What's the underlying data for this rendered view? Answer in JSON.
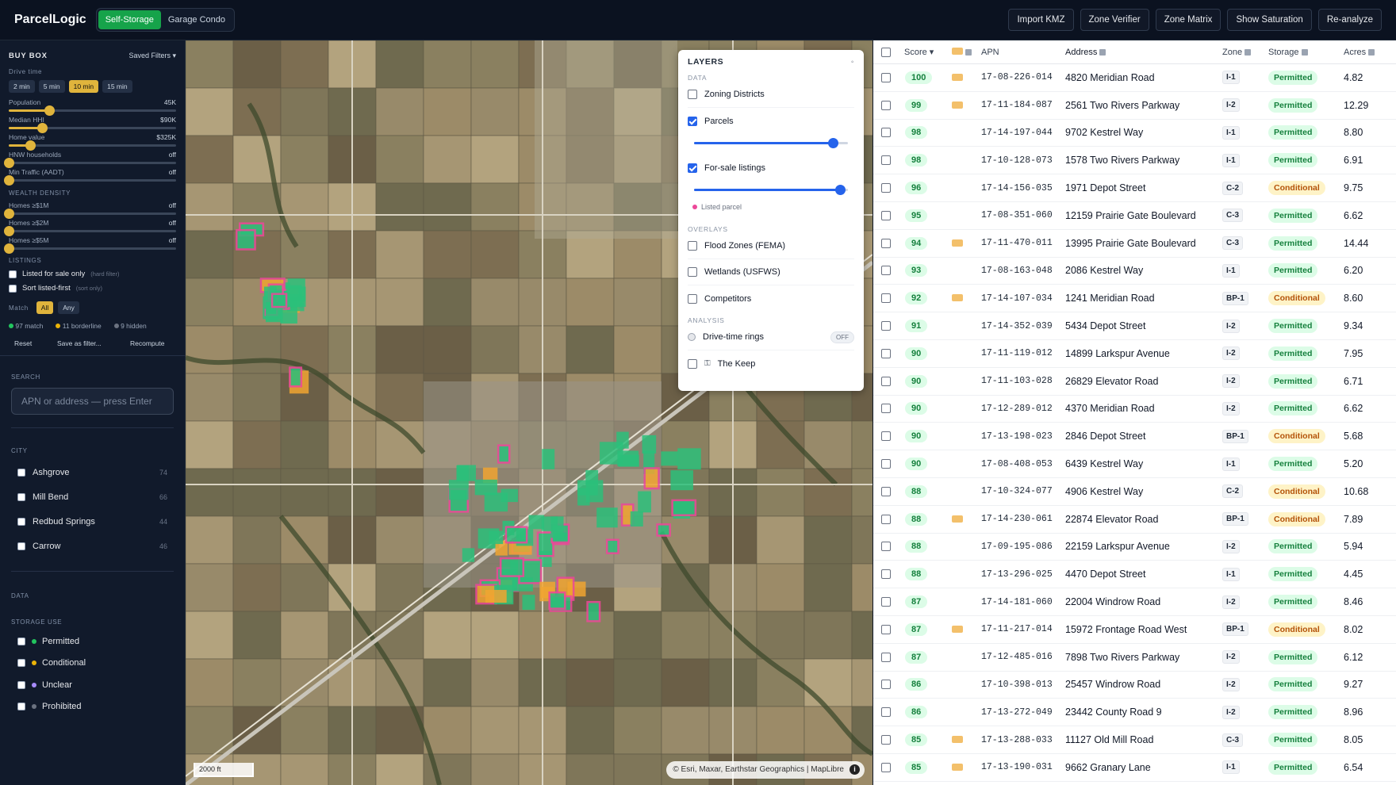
{
  "app": {
    "title": "ParcelLogic"
  },
  "mode_tabs": [
    {
      "label": "Self-Storage",
      "active": true
    },
    {
      "label": "Garage Condo",
      "active": false
    }
  ],
  "toolbar": {
    "buttons": [
      "Import KMZ",
      "Zone Verifier",
      "Zone Matrix",
      "Show Saturation",
      "Re-analyze"
    ]
  },
  "buybox": {
    "title": "BUY BOX",
    "saved_filters": "Saved Filters ▾",
    "drive_time_label": "Drive time",
    "drive_times": [
      {
        "label": "2 min",
        "active": false
      },
      {
        "label": "5 min",
        "active": false
      },
      {
        "label": "10 min",
        "active": true
      },
      {
        "label": "15 min",
        "active": false
      }
    ],
    "sliders": [
      {
        "label": "Population",
        "value": "45K",
        "level": 0.24
      },
      {
        "label": "Median HHI",
        "value": "$90K",
        "level": 0.2
      },
      {
        "label": "Home value",
        "value": "$325K",
        "level": 0.13
      },
      {
        "label": "HNW households",
        "value": "off",
        "level": 0
      }
    ],
    "traffic": {
      "label": "Min Traffic (AADT)",
      "value": "off",
      "level": 0
    },
    "wealth_label": "WEALTH DENSITY",
    "wealth": [
      {
        "label": "Homes ≥$1M",
        "value": "off",
        "level": 0
      },
      {
        "label": "Homes ≥$2M",
        "value": "off",
        "level": 0
      },
      {
        "label": "Homes ≥$5M",
        "value": "off",
        "level": 0
      }
    ],
    "listings_label": "LISTINGS",
    "listed_only": {
      "label": "Listed for sale only",
      "note": "(hard filter)"
    },
    "sort_listed": {
      "label": "Sort listed-first",
      "note": "(sort only)"
    },
    "match_label": "Match",
    "match_all": "All",
    "match_any": "Any",
    "counts": [
      {
        "text": "97 match",
        "color": "#22c55e"
      },
      {
        "text": "11 borderline",
        "color": "#eab308"
      },
      {
        "text": "9 hidden",
        "color": "#6b7280"
      }
    ],
    "actions": [
      "Reset",
      "Save as filter...",
      "Recompute"
    ]
  },
  "search": {
    "label": "SEARCH",
    "placeholder": "APN or address — press Enter"
  },
  "city": {
    "label": "CITY",
    "items": [
      {
        "name": "Ashgrove",
        "count": "74"
      },
      {
        "name": "Mill Bend",
        "count": "66"
      },
      {
        "name": "Redbud Springs",
        "count": "44"
      },
      {
        "name": "Carrow",
        "count": "46"
      }
    ]
  },
  "data_label": "DATA",
  "storage_use": {
    "label": "STORAGE USE",
    "items": [
      {
        "name": "Permitted",
        "color": "#22c55e"
      },
      {
        "name": "Conditional",
        "color": "#eab308"
      },
      {
        "name": "Unclear",
        "color": "#a78bfa"
      },
      {
        "name": "Prohibited",
        "color": "#6b7280"
      }
    ]
  },
  "map": {
    "scale": "2000 ft",
    "attribution": "© Esri, Maxar, Earthstar Geographics | MapLibre"
  },
  "layers": {
    "title": "LAYERS",
    "close": "◦",
    "data_label": "DATA",
    "zoning": "Zoning Districts",
    "parcels": {
      "label": "Parcels",
      "checked": true,
      "opacity": 0.9
    },
    "listings": {
      "label": "For-sale listings",
      "checked": true,
      "opacity": 0.95
    },
    "listed_legend": "Listed parcel",
    "overlays_label": "OVERLAYS",
    "overlays": [
      "Flood Zones (FEMA)",
      "Wetlands (USFWS)",
      "Competitors"
    ],
    "analysis_label": "ANALYSIS",
    "drive_rings": "Drive-time rings",
    "drive_rings_state": "OFF",
    "keep": "The Keep"
  },
  "table": {
    "columns": [
      "Score ▾",
      "",
      "APN",
      "Address",
      "Zone",
      "Storage",
      "Acres"
    ],
    "rows": [
      {
        "score": "100",
        "listed": true,
        "apn": "17-08-226-014",
        "address": "4820 Meridian Road",
        "zone": "I-1",
        "storage": "Permitted",
        "acres": "4.82"
      },
      {
        "score": "99",
        "listed": true,
        "apn": "17-11-184-087",
        "address": "2561 Two Rivers Parkway",
        "zone": "I-2",
        "storage": "Permitted",
        "acres": "12.29"
      },
      {
        "score": "98",
        "listed": false,
        "apn": "17-14-197-044",
        "address": "9702 Kestrel Way",
        "zone": "I-1",
        "storage": "Permitted",
        "acres": "8.80"
      },
      {
        "score": "98",
        "listed": false,
        "apn": "17-10-128-073",
        "address": "1578 Two Rivers Parkway",
        "zone": "I-1",
        "storage": "Permitted",
        "acres": "6.91"
      },
      {
        "score": "96",
        "listed": false,
        "apn": "17-14-156-035",
        "address": "1971 Depot Street",
        "zone": "C-2",
        "storage": "Conditional",
        "acres": "9.75"
      },
      {
        "score": "95",
        "listed": false,
        "apn": "17-08-351-060",
        "address": "12159 Prairie Gate Boulevard",
        "zone": "C-3",
        "storage": "Permitted",
        "acres": "6.62"
      },
      {
        "score": "94",
        "listed": true,
        "apn": "17-11-470-011",
        "address": "13995 Prairie Gate Boulevard",
        "zone": "C-3",
        "storage": "Permitted",
        "acres": "14.44"
      },
      {
        "score": "93",
        "listed": false,
        "apn": "17-08-163-048",
        "address": "2086 Kestrel Way",
        "zone": "I-1",
        "storage": "Permitted",
        "acres": "6.20"
      },
      {
        "score": "92",
        "listed": true,
        "apn": "17-14-107-034",
        "address": "1241 Meridian Road",
        "zone": "BP-1",
        "storage": "Conditional",
        "acres": "8.60"
      },
      {
        "score": "91",
        "listed": false,
        "apn": "17-14-352-039",
        "address": "5434 Depot Street",
        "zone": "I-2",
        "storage": "Permitted",
        "acres": "9.34"
      },
      {
        "score": "90",
        "listed": false,
        "apn": "17-11-119-012",
        "address": "14899 Larkspur Avenue",
        "zone": "I-2",
        "storage": "Permitted",
        "acres": "7.95"
      },
      {
        "score": "90",
        "listed": false,
        "apn": "17-11-103-028",
        "address": "26829 Elevator Road",
        "zone": "I-2",
        "storage": "Permitted",
        "acres": "6.71"
      },
      {
        "score": "90",
        "listed": false,
        "apn": "17-12-289-012",
        "address": "4370 Meridian Road",
        "zone": "I-2",
        "storage": "Permitted",
        "acres": "6.62"
      },
      {
        "score": "90",
        "listed": false,
        "apn": "17-13-198-023",
        "address": "2846 Depot Street",
        "zone": "BP-1",
        "storage": "Conditional",
        "acres": "5.68"
      },
      {
        "score": "90",
        "listed": false,
        "apn": "17-08-408-053",
        "address": "6439 Kestrel Way",
        "zone": "I-1",
        "storage": "Permitted",
        "acres": "5.20"
      },
      {
        "score": "88",
        "listed": false,
        "apn": "17-10-324-077",
        "address": "4906 Kestrel Way",
        "zone": "C-2",
        "storage": "Conditional",
        "acres": "10.68"
      },
      {
        "score": "88",
        "listed": true,
        "apn": "17-14-230-061",
        "address": "22874 Elevator Road",
        "zone": "BP-1",
        "storage": "Conditional",
        "acres": "7.89"
      },
      {
        "score": "88",
        "listed": false,
        "apn": "17-09-195-086",
        "address": "22159 Larkspur Avenue",
        "zone": "I-2",
        "storage": "Permitted",
        "acres": "5.94"
      },
      {
        "score": "88",
        "listed": false,
        "apn": "17-13-296-025",
        "address": "4470 Depot Street",
        "zone": "I-1",
        "storage": "Permitted",
        "acres": "4.45"
      },
      {
        "score": "87",
        "listed": false,
        "apn": "17-14-181-060",
        "address": "22004 Windrow Road",
        "zone": "I-2",
        "storage": "Permitted",
        "acres": "8.46"
      },
      {
        "score": "87",
        "listed": true,
        "apn": "17-11-217-014",
        "address": "15972 Frontage Road West",
        "zone": "BP-1",
        "storage": "Conditional",
        "acres": "8.02"
      },
      {
        "score": "87",
        "listed": false,
        "apn": "17-12-485-016",
        "address": "7898 Two Rivers Parkway",
        "zone": "I-2",
        "storage": "Permitted",
        "acres": "6.12"
      },
      {
        "score": "86",
        "listed": false,
        "apn": "17-10-398-013",
        "address": "25457 Windrow Road",
        "zone": "I-2",
        "storage": "Permitted",
        "acres": "9.27"
      },
      {
        "score": "86",
        "listed": false,
        "apn": "17-13-272-049",
        "address": "23442 County Road 9",
        "zone": "I-2",
        "storage": "Permitted",
        "acres": "8.96"
      },
      {
        "score": "85",
        "listed": true,
        "apn": "17-13-288-033",
        "address": "11127 Old Mill Road",
        "zone": "C-3",
        "storage": "Permitted",
        "acres": "8.05"
      },
      {
        "score": "85",
        "listed": true,
        "apn": "17-13-190-031",
        "address": "9662 Granary Lane",
        "zone": "I-1",
        "storage": "Permitted",
        "acres": "6.54"
      }
    ]
  }
}
